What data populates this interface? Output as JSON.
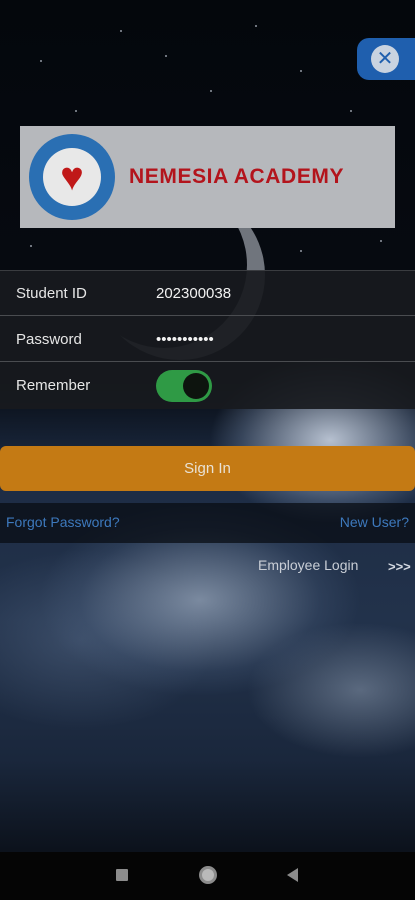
{
  "header": {
    "close_icon": "close-icon",
    "brand_name": "NEMESIA ACADEMY",
    "logo_icon": "academy-seal-icon"
  },
  "form": {
    "student_id_label": "Student ID",
    "student_id_value": "202300038",
    "password_label": "Password",
    "password_value": "•••••••••••",
    "remember_label": "Remember",
    "remember_on": true
  },
  "actions": {
    "sign_in_label": "Sign In",
    "forgot_password_label": "Forgot Password?",
    "new_user_label": "New User?",
    "employee_login_label": "Employee Login",
    "employee_login_arrows": ">>>"
  },
  "colors": {
    "accent_button": "#c47a14",
    "link": "#3d79bd",
    "toggle_on": "#2f9a45",
    "close_button": "#1f5fae",
    "brand_text": "#b3141c"
  },
  "navbar": {
    "recents_icon": "square-icon",
    "home_icon": "circle-home-icon",
    "back_icon": "triangle-back-icon"
  }
}
